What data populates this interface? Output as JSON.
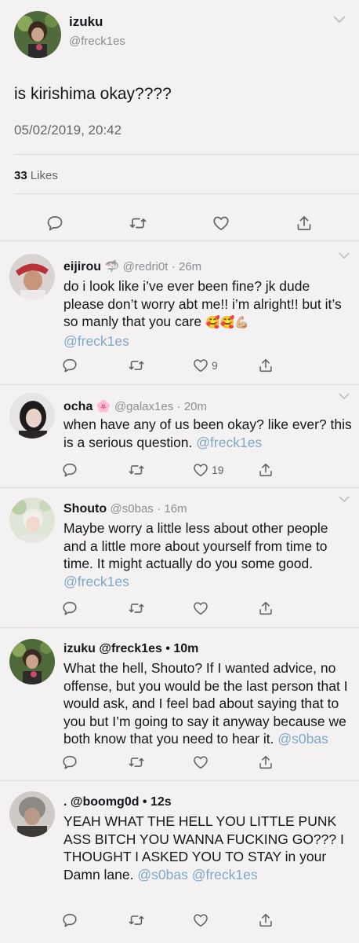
{
  "main": {
    "name": "izuku",
    "handle": "@freck1es",
    "text": "is kirishima okay????",
    "timestamp": "05/02/2019, 20:42",
    "likes_count": "33",
    "likes_label": "Likes"
  },
  "replies": [
    {
      "name": "eijirou",
      "badge": "🦈",
      "handle": "@redri0t",
      "time": "· 26m",
      "text": "do i look like i’ve ever been fine? jk dude please don’t worry abt me!! i’m alright!! but it’s so manly that you care",
      "emojis": "🥰🥰💪🏼",
      "mentions": "@freck1es",
      "likes": "9"
    },
    {
      "name": "ocha",
      "badge": "🌸",
      "handle": "@galax1es",
      "time": "· 20m",
      "text": "when have any of us been okay? like ever? this is a serious question.",
      "mentions": "@freck1es",
      "likes": "19"
    },
    {
      "name": "Shouto",
      "handle": "@s0bas",
      "time": "· 16m",
      "text": "Maybe worry a little less about other people and a little more about yourself from time to time. It might actually do you some good.",
      "mentions": "@freck1es",
      "likes": ""
    },
    {
      "name": "izuku @freck1es • 10m",
      "text": "What the hell, Shouto? If I wanted advice, no offense, but you would be the last person that I would ask, and I feel bad about saying that to you but I’m going to say it anyway because we both know that you need to hear it.",
      "mentions": "@s0bas",
      "likes": ""
    },
    {
      "name": ". @boomg0d • 12s",
      "text": "YEAH WHAT THE HELL YOU LITTLE PUNK ASS BITCH YOU WANNA FUCKING GO??? I THOUGHT I ASKED YOU TO STAY in your Damn lane.",
      "mentions": "@s0bas @freck1es",
      "likes": ""
    }
  ],
  "colors": {
    "background": "#f4f1f3",
    "mention": "#7fa8c4",
    "icon": "#5f6468"
  },
  "icons": [
    "chevron-down-icon",
    "reply-icon",
    "retweet-icon",
    "like-icon",
    "share-icon"
  ]
}
